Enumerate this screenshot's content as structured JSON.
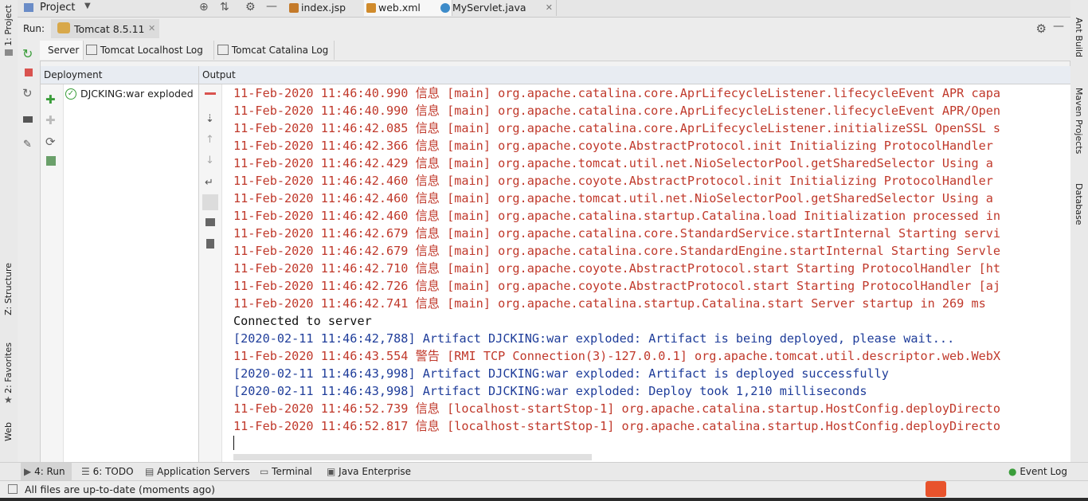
{
  "left_strip": {
    "project": "1: Project",
    "structure": "Z: Structure",
    "favorites": "2: Favorites",
    "web": "Web"
  },
  "right_strip": {
    "ant": "Ant Build",
    "maven": "Maven Projects",
    "database": "Database"
  },
  "top_bar": {
    "project_label": "Project",
    "tabs": [
      {
        "label": "index.jsp",
        "color": "#c47a2a"
      },
      {
        "label": "web.xml",
        "color": "#d08b2c"
      },
      {
        "label": "MyServlet.java",
        "color": "#3d8bc9"
      }
    ],
    "close_glyph": "✕"
  },
  "run_bar": {
    "run_label": "Run:",
    "config": "Tomcat 8.5.11",
    "close_glyph": "✕"
  },
  "server_tabs": [
    {
      "label": "Server"
    },
    {
      "label": "Tomcat Localhost Log"
    },
    {
      "label": "Tomcat Catalina Log"
    }
  ],
  "deployment": {
    "header": "Deployment",
    "item": "DJCKING:war exploded"
  },
  "output": {
    "header": "Output",
    "lines": [
      {
        "text": "11-Feb-2020 11:46:40.990 信息 [main] org.apache.catalina.core.AprLifecycleListener.lifecycleEvent APR capa",
        "tone": "red"
      },
      {
        "text": "11-Feb-2020 11:46:40.990 信息 [main] org.apache.catalina.core.AprLifecycleListener.lifecycleEvent APR/Open",
        "tone": "red"
      },
      {
        "text": "11-Feb-2020 11:46:42.085 信息 [main] org.apache.catalina.core.AprLifecycleListener.initializeSSL OpenSSL s",
        "tone": "red"
      },
      {
        "text": "11-Feb-2020 11:46:42.366 信息 [main] org.apache.coyote.AbstractProtocol.init Initializing ProtocolHandler",
        "tone": "red"
      },
      {
        "text": "11-Feb-2020 11:46:42.429 信息 [main] org.apache.tomcat.util.net.NioSelectorPool.getSharedSelector Using a",
        "tone": "red"
      },
      {
        "text": "11-Feb-2020 11:46:42.460 信息 [main] org.apache.coyote.AbstractProtocol.init Initializing ProtocolHandler",
        "tone": "red"
      },
      {
        "text": "11-Feb-2020 11:46:42.460 信息 [main] org.apache.tomcat.util.net.NioSelectorPool.getSharedSelector Using a",
        "tone": "red"
      },
      {
        "text": "11-Feb-2020 11:46:42.460 信息 [main] org.apache.catalina.startup.Catalina.load Initialization processed in",
        "tone": "red"
      },
      {
        "text": "11-Feb-2020 11:46:42.679 信息 [main] org.apache.catalina.core.StandardService.startInternal Starting servi",
        "tone": "red"
      },
      {
        "text": "11-Feb-2020 11:46:42.679 信息 [main] org.apache.catalina.core.StandardEngine.startInternal Starting Servle",
        "tone": "red"
      },
      {
        "text": "11-Feb-2020 11:46:42.710 信息 [main] org.apache.coyote.AbstractProtocol.start Starting ProtocolHandler [ht",
        "tone": "red"
      },
      {
        "text": "11-Feb-2020 11:46:42.726 信息 [main] org.apache.coyote.AbstractProtocol.start Starting ProtocolHandler [aj",
        "tone": "red"
      },
      {
        "text": "11-Feb-2020 11:46:42.741 信息 [main] org.apache.catalina.startup.Catalina.start Server startup in 269 ms",
        "tone": "red"
      },
      {
        "text": "Connected to server",
        "tone": "black"
      },
      {
        "text": "[2020-02-11 11:46:42,788] Artifact DJCKING:war exploded: Artifact is being deployed, please wait...",
        "tone": "blue"
      },
      {
        "text": "11-Feb-2020 11:46:43.554 警告 [RMI TCP Connection(3)-127.0.0.1] org.apache.tomcat.util.descriptor.web.WebX",
        "tone": "red"
      },
      {
        "text": "[2020-02-11 11:46:43,998] Artifact DJCKING:war exploded: Artifact is deployed successfully",
        "tone": "blue"
      },
      {
        "text": "[2020-02-11 11:46:43,998] Artifact DJCKING:war exploded: Deploy took 1,210 milliseconds",
        "tone": "blue"
      },
      {
        "text": "11-Feb-2020 11:46:52.739 信息 [localhost-startStop-1] org.apache.catalina.startup.HostConfig.deployDirecto",
        "tone": "red"
      },
      {
        "text": "11-Feb-2020 11:46:52.817 信息 [localhost-startStop-1] org.apache.catalina.startup.HostConfig.deployDirecto",
        "tone": "red"
      }
    ]
  },
  "bottom_tools": [
    {
      "label": "4: Run"
    },
    {
      "label": "6: TODO"
    },
    {
      "label": "Application Servers"
    },
    {
      "label": "Terminal"
    },
    {
      "label": "Java Enterprise"
    }
  ],
  "event_log": "Event Log",
  "status": {
    "text": "All files are up-to-date (moments ago)"
  },
  "colors": {
    "log_red": "#c0392b",
    "log_blue": "#1f3d9a",
    "run_green": "#3a9d3a",
    "stop_red": "#d9534f"
  }
}
